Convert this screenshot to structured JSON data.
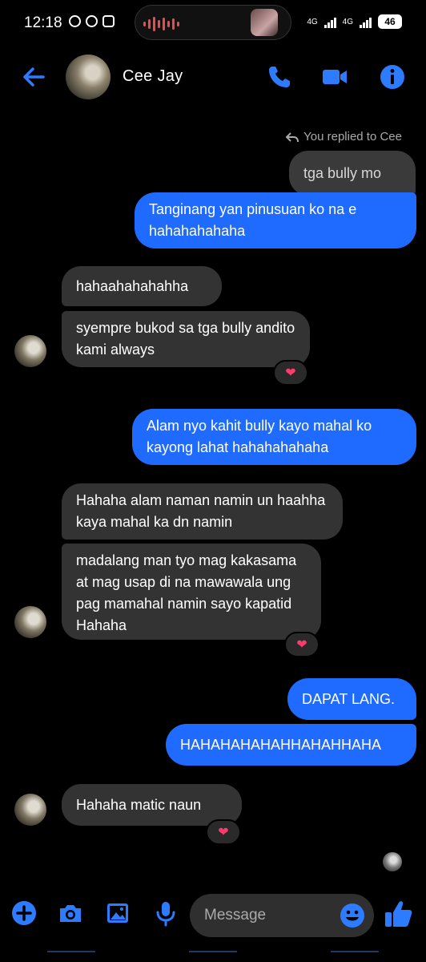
{
  "status_bar": {
    "time": "12:18",
    "net1": "4G",
    "net2": "4G",
    "battery": "46"
  },
  "header": {
    "contact_name": "Cee Jay",
    "back_icon": "arrow-left-icon",
    "call_icon": "phone-icon",
    "video_icon": "video-camera-icon",
    "info_icon": "info-icon"
  },
  "chat": {
    "replied_label": "You replied to Cee",
    "quoted_text": "tga bully mo",
    "messages": [
      {
        "dir": "out",
        "text": "Tanginang yan pinusuan ko na e hahahahahaha"
      },
      {
        "dir": "in",
        "text": "hahaahahahahha"
      },
      {
        "dir": "in",
        "text": "syempre bukod sa tga bully andito kami always",
        "reaction": "❤"
      },
      {
        "dir": "out",
        "text": "Alam nyo kahit bully kayo mahal ko kayong lahat hahahahahaha"
      },
      {
        "dir": "in",
        "text": "Hahaha alam naman namin un haahha kaya mahal ka dn namin"
      },
      {
        "dir": "in",
        "text": "madalang man tyo mag kakasama at mag usap di na mawawala ung pag mamahal namin sayo kapatid Hahaha",
        "reaction": "❤"
      },
      {
        "dir": "out",
        "text": "DAPAT LANG."
      },
      {
        "dir": "out",
        "text": "HAHAHAHAHAHHAHAHHAHA"
      },
      {
        "dir": "in",
        "text": "Hahaha matic naun",
        "reaction": "❤"
      }
    ]
  },
  "composer": {
    "placeholder": "Message",
    "icons": [
      "plus-icon",
      "camera-icon",
      "image-icon",
      "microphone-icon",
      "emoji-icon",
      "thumbs-up-icon"
    ]
  },
  "colors": {
    "accent": "#1f6bff",
    "incoming_bubble": "#333333",
    "background": "#000000"
  }
}
